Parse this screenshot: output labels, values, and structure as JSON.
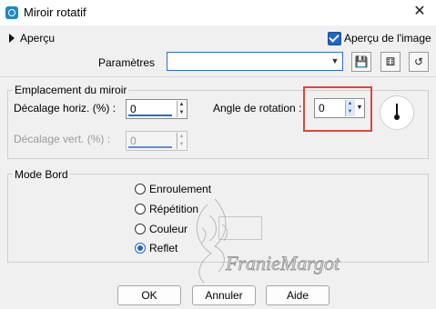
{
  "window": {
    "title": "Miroir rotatif",
    "close_glyph": "✕"
  },
  "preview": {
    "label": "Aperçu",
    "checkbox_label": "Aperçu de l'image",
    "checked": true
  },
  "params": {
    "label": "Paramètres",
    "value": ""
  },
  "toolbar_icons": [
    "save-icon",
    "dice-icon",
    "reset-icon"
  ],
  "mirror": {
    "group_title": "Emplacement du miroir",
    "offset_h_label": "Décalage horiz. (%) :",
    "offset_h_value": "0",
    "offset_v_label": "Décalage vert. (%) :",
    "offset_v_value": "0",
    "angle_label": "Angle de rotation :",
    "angle_value": "0"
  },
  "edge": {
    "group_title": "Mode Bord",
    "options": [
      {
        "label": "Enroulement",
        "selected": false
      },
      {
        "label": "Répétition",
        "selected": false
      },
      {
        "label": "Couleur",
        "selected": false
      },
      {
        "label": "Reflet",
        "selected": true
      }
    ]
  },
  "buttons": {
    "ok": "OK",
    "cancel": "Annuler",
    "help": "Aide"
  },
  "watermark": {
    "text": "FranieMargot"
  },
  "colors": {
    "accent": "#1f64c7",
    "highlight_box": "#e0453a"
  }
}
